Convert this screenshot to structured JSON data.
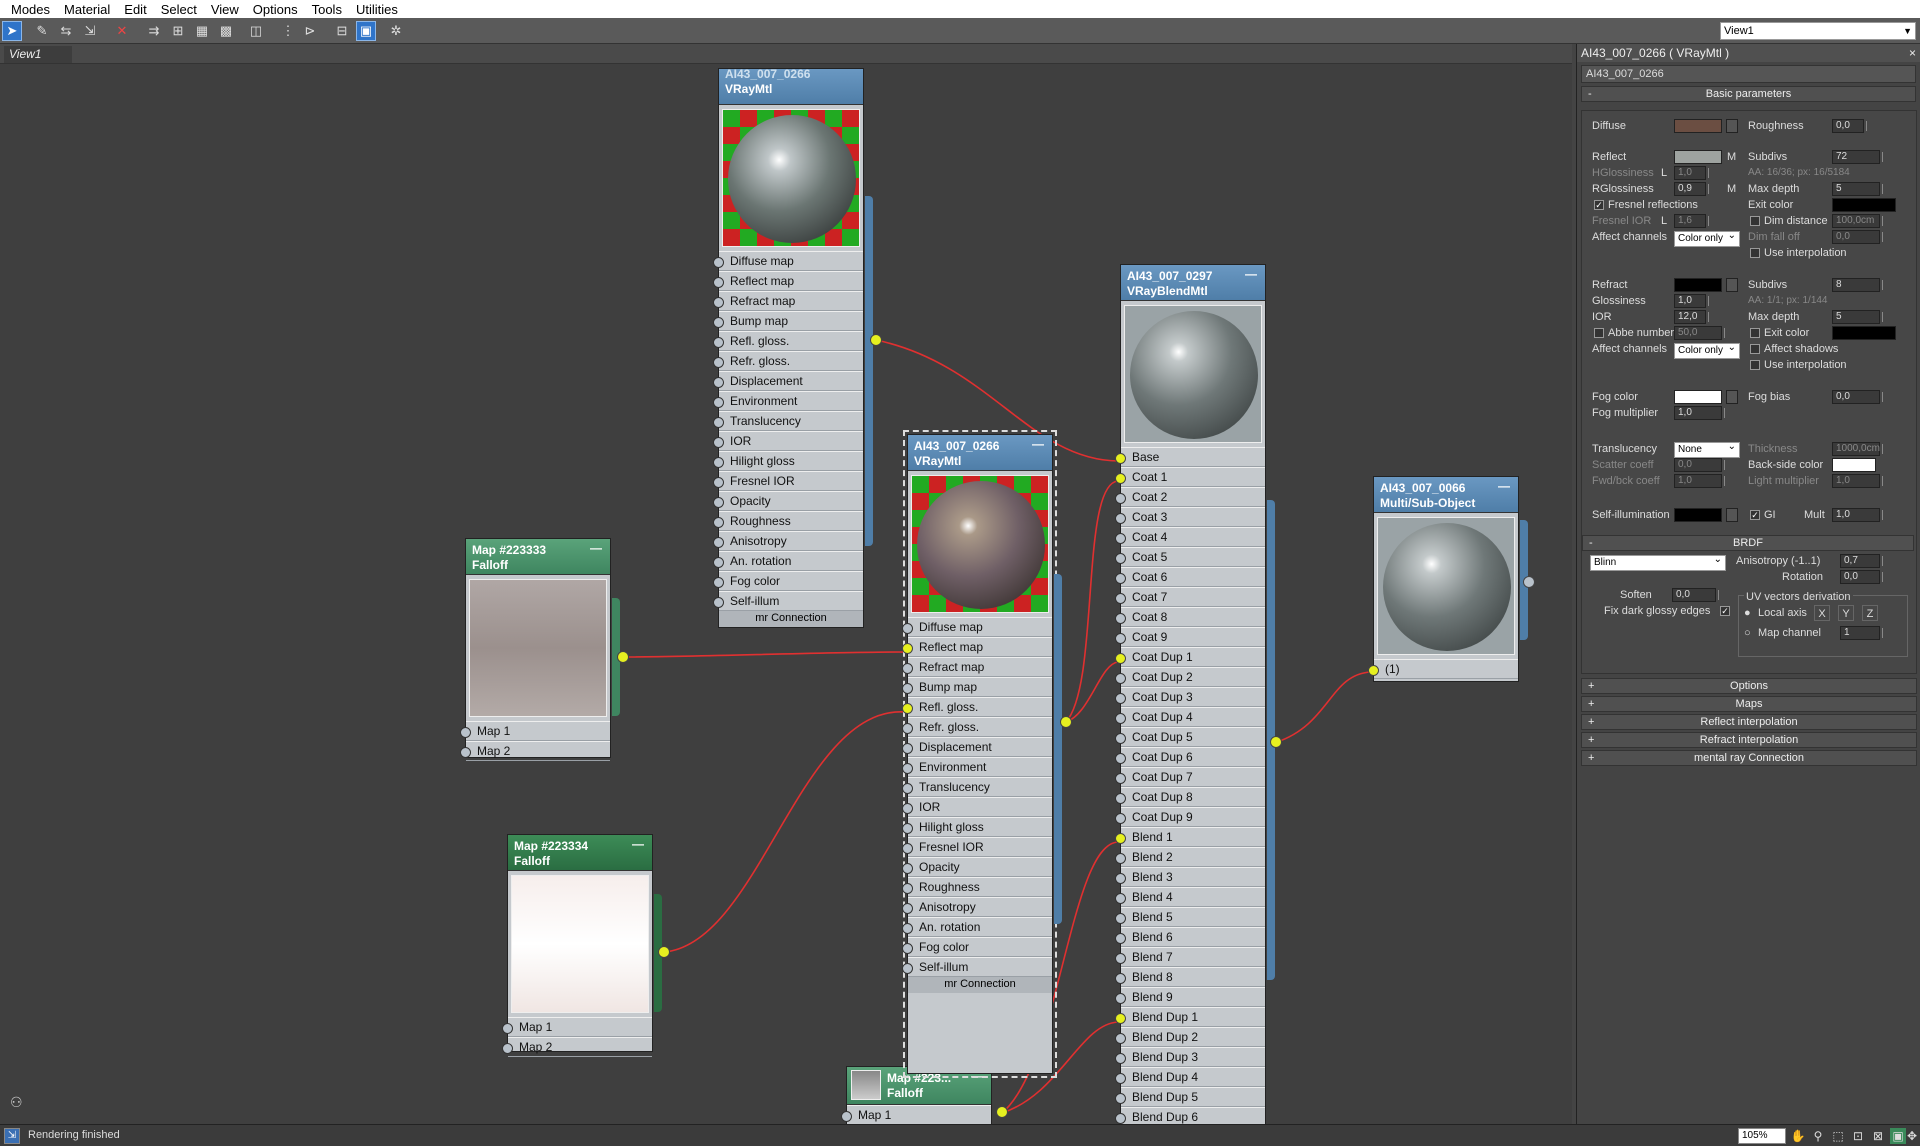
{
  "menu": [
    "Modes",
    "Material",
    "Edit",
    "Select",
    "View",
    "Options",
    "Tools",
    "Utilities"
  ],
  "toolbar_icons": [
    "select-icon",
    "pick-material-icon",
    "put-material-icon",
    "assign-material-icon",
    "delete-icon",
    "move-children-icon",
    "layout-all-icon",
    "background-icon",
    "checker-icon",
    "show-map-icon",
    "lay-out-icon",
    "hide-unused-icon",
    "material-map-navigator-icon",
    "options-icon"
  ],
  "view_select": "View1",
  "view_tab": "View1",
  "nodes": {
    "vraymtl_top": {
      "title1": "AI43_007_0266",
      "title2": "VRayMtl",
      "slots": [
        "Diffuse map",
        "Reflect map",
        "Refract map",
        "Bump map",
        "Refl. gloss.",
        "Refr. gloss.",
        "Displacement",
        "Environment",
        "Translucency",
        "IOR",
        "Hilight gloss",
        "Fresnel IOR",
        "Opacity",
        "Roughness",
        "Anisotropy",
        "An. rotation",
        "Fog color",
        "Self-illum"
      ],
      "footer": "mr Connection"
    },
    "falloff1": {
      "title1": "Map #223333",
      "title2": "Falloff",
      "slots": [
        "Map 1",
        "Map 2"
      ]
    },
    "falloff2": {
      "title1": "Map #223334",
      "title2": "Falloff",
      "slots": [
        "Map 1",
        "Map 2"
      ]
    },
    "falloff3": {
      "title1": "Map #223...",
      "title2": "Falloff",
      "slots": [
        "Map 1"
      ]
    },
    "vraymtl_mid": {
      "title1": "AI43_007_0266",
      "title2": "VRayMtl",
      "slots": [
        "Diffuse map",
        "Reflect map",
        "Refract map",
        "Bump map",
        "Refl. gloss.",
        "Refr. gloss.",
        "Displacement",
        "Environment",
        "Translucency",
        "IOR",
        "Hilight gloss",
        "Fresnel IOR",
        "Opacity",
        "Roughness",
        "Anisotropy",
        "An. rotation",
        "Fog color",
        "Self-illum"
      ],
      "footer": "mr Connection"
    },
    "blend": {
      "title1": "AI43_007_0297",
      "title2": "VRayBlendMtl",
      "slots": [
        "Base",
        "Coat 1",
        "Coat 2",
        "Coat 3",
        "Coat 4",
        "Coat 5",
        "Coat 6",
        "Coat 7",
        "Coat 8",
        "Coat 9",
        "Coat Dup 1",
        "Coat Dup 2",
        "Coat Dup 3",
        "Coat Dup 4",
        "Coat Dup 5",
        "Coat Dup 6",
        "Coat Dup 7",
        "Coat Dup 8",
        "Coat Dup 9",
        "Blend 1",
        "Blend 2",
        "Blend 3",
        "Blend 4",
        "Blend 5",
        "Blend 6",
        "Blend 7",
        "Blend 8",
        "Blend 9",
        "Blend Dup 1",
        "Blend Dup 2",
        "Blend Dup 3",
        "Blend Dup 4",
        "Blend Dup 5",
        "Blend Dup 6"
      ]
    },
    "multi": {
      "title1": "AI43_007_0066",
      "title2": "Multi/Sub-Object",
      "slots": [
        "(1)"
      ]
    }
  },
  "panel": {
    "title": "AI43_007_0266  ( VRayMtl )",
    "name": "AI43_007_0266",
    "basic_params": "Basic parameters",
    "diffuse": "Diffuse",
    "roughness": "Roughness",
    "roughness_val": "0,0",
    "reflect": "Reflect",
    "m": "M",
    "subdivs": "Subdivs",
    "subdivs_val": "72",
    "hgloss": "HGlossiness",
    "l": "L",
    "hgloss_val": "1,0",
    "aa1": "AA: 16/36; px: 16/5184",
    "rgloss": "RGlossiness",
    "rgloss_val": "0,9",
    "maxdepth": "Max depth",
    "maxdepth_val": "5",
    "fresnel": "Fresnel reflections",
    "exitcolor": "Exit color",
    "fresnel_ior": "Fresnel IOR",
    "fresnel_ior_val": "1,6",
    "dimdist": "Dim distance",
    "dimdist_val": "100,0cm",
    "affect": "Affect channels",
    "color_only": "Color only",
    "dimfall": "Dim fall off",
    "dimfall_val": "0,0",
    "useinterp": "Use interpolation",
    "refract": "Refract",
    "r_subdivs_val": "8",
    "glossiness": "Glossiness",
    "gloss_val": "1,0",
    "aa2": "AA: 1/1; px: 1/144",
    "ior": "IOR",
    "ior_val": "12,0",
    "r_maxdepth_val": "5",
    "abbe": "Abbe number",
    "abbe_val": "50,0",
    "r_exit": "Exit color",
    "affect_shadows": "Affect shadows",
    "fogcolor": "Fog color",
    "fogbias": "Fog bias",
    "fogbias_val": "0,0",
    "fogmult": "Fog multiplier",
    "fogmult_val": "1,0",
    "translucency": "Translucency",
    "trans_val": "None",
    "thickness": "Thickness",
    "thickness_val": "1000,0cm",
    "scatter": "Scatter coeff",
    "scatter_val": "0,0",
    "backside": "Back-side color",
    "fwdbck": "Fwd/bck coeff",
    "fwdbck_val": "1,0",
    "lightmult": "Light multiplier",
    "lightmult_val": "1,0",
    "selfillum": "Self-illumination",
    "gi": "GI",
    "mult": "Mult",
    "mult_val": "1,0",
    "brdf": "BRDF",
    "brdf_type": "Blinn",
    "aniso": "Anisotropy (-1..1)",
    "aniso_val": "0,7",
    "rotation": "Rotation",
    "rotation_val": "0,0",
    "soften": "Soften",
    "soften_val": "0,0",
    "uvderiv": "UV vectors derivation",
    "fixdark": "Fix dark glossy edges",
    "localaxis": "Local axis",
    "x": "X",
    "y": "Y",
    "z": "Z",
    "mapchannel": "Map channel",
    "mapchannel_val": "1",
    "rollouts": [
      "Options",
      "Maps",
      "Reflect interpolation",
      "Refract interpolation",
      "mental ray Connection"
    ]
  },
  "status": {
    "text": "Rendering finished",
    "zoom": "105%"
  },
  "colors": {
    "diffuse": "#6b4e42",
    "reflect": "#9ea3a0",
    "refract": "#000000",
    "fog": "#ffffff",
    "wire": "#e03030",
    "socket_on": "#e6f020"
  }
}
